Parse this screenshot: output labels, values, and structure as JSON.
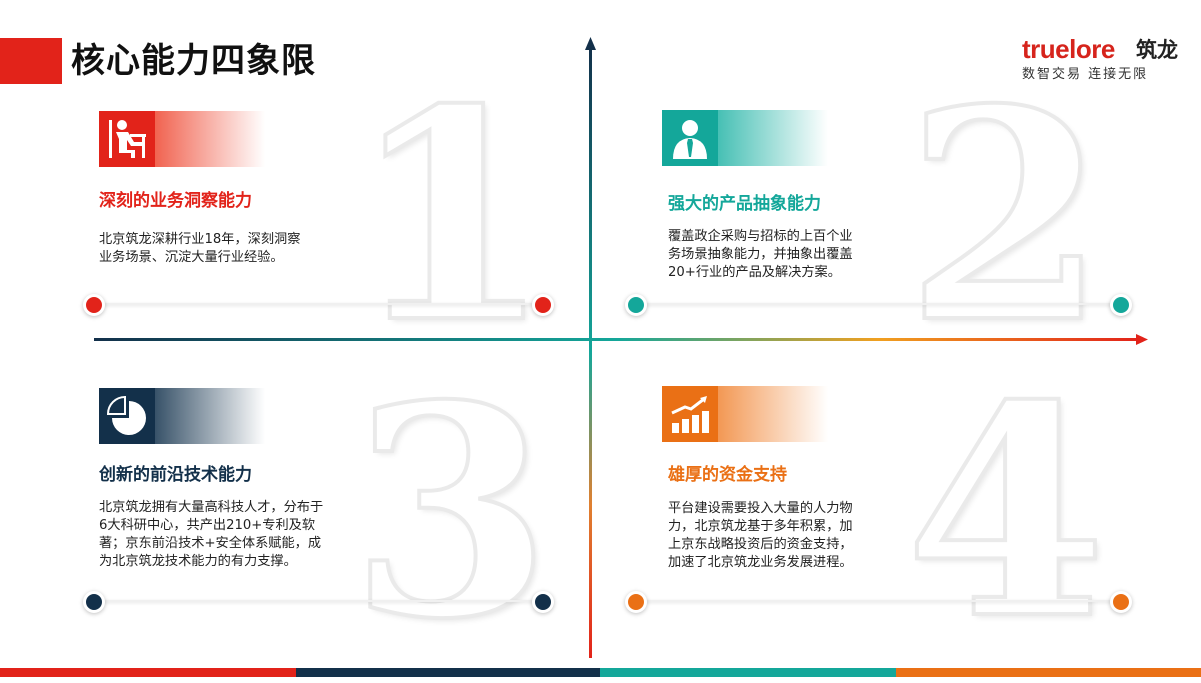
{
  "page": {
    "title": "核心能力四象限"
  },
  "logo": {
    "brand": "truelore",
    "brand_cn": "筑龙",
    "slogan": "数智交易 连接无限"
  },
  "colors": {
    "red": "#e2231a",
    "teal": "#14a79a",
    "navy": "#13304a",
    "orange": "#ea7015"
  },
  "quadrants": [
    {
      "number": "1",
      "icon": "worker-at-desk-icon",
      "heading": "深刻的业务洞察能力",
      "lines": [
        "北京筑龙深耕行业18年，深刻洞察",
        "业务场景、沉淀大量行业经验。"
      ]
    },
    {
      "number": "2",
      "icon": "person-bust-icon",
      "heading": "强大的产品抽象能力",
      "lines": [
        "覆盖政企采购与招标的上百个业",
        "务场景抽象能力，并抽象出覆盖",
        "20+行业的产品及解决方案。"
      ]
    },
    {
      "number": "3",
      "icon": "pie-chart-icon",
      "heading": "创新的前沿技术能力",
      "lines": [
        "北京筑龙拥有大量高科技人才，分布于",
        "6大科研中心，共产出210+专利及软",
        "著；京东前沿技术+安全体系赋能，成",
        "为北京筑龙技术能力的有力支撑。"
      ]
    },
    {
      "number": "4",
      "icon": "growth-bar-chart-icon",
      "heading": "雄厚的资金支持",
      "lines": [
        "平台建设需要投入大量的人力物",
        "力，北京筑龙基于多年积累，加",
        "上京东战略投资后的资金支持，",
        "加速了北京筑龙业务发展进程。"
      ]
    }
  ]
}
